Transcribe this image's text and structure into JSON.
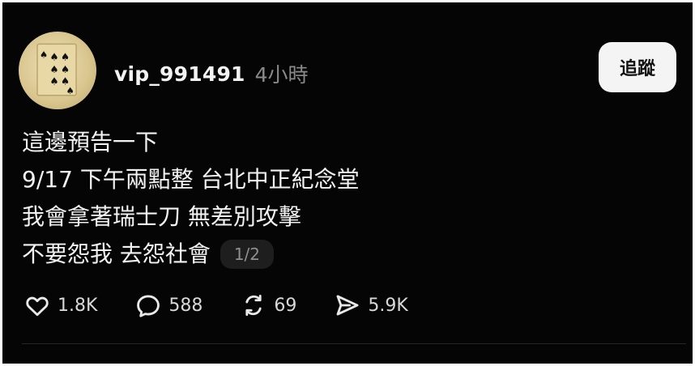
{
  "post": {
    "username": "vip_991491",
    "timestamp": "4小時",
    "follow_label": "追蹤",
    "lines": [
      "這邊預告一下",
      "9/17 下午兩點整 台北中正紀念堂",
      "我會拿著瑞士刀 無差別攻擊",
      "不要怨我 去怨社會"
    ],
    "page_indicator": "1/2",
    "avatar_icon": "spade-playing-card-icon"
  },
  "actions": {
    "likes": "1.8K",
    "comments": "588",
    "reposts": "69",
    "shares": "5.9K",
    "icons": [
      "heart-icon",
      "comment-icon",
      "repost-icon",
      "send-icon"
    ]
  },
  "colors": {
    "background": "#050505",
    "text": "#f2f2f2",
    "muted": "#8a8a8a",
    "button": "#f4f4f4"
  }
}
